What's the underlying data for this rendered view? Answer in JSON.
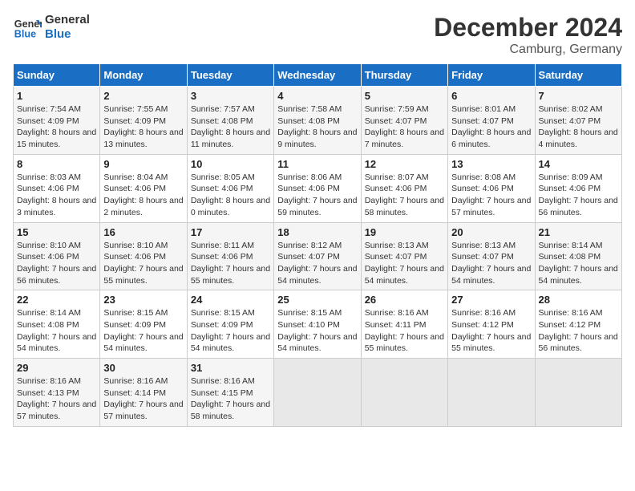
{
  "header": {
    "logo_line1": "General",
    "logo_line2": "Blue",
    "title": "December 2024",
    "subtitle": "Camburg, Germany"
  },
  "weekdays": [
    "Sunday",
    "Monday",
    "Tuesday",
    "Wednesday",
    "Thursday",
    "Friday",
    "Saturday"
  ],
  "weeks": [
    [
      {
        "day": "1",
        "sunrise": "Sunrise: 7:54 AM",
        "sunset": "Sunset: 4:09 PM",
        "daylight": "Daylight: 8 hours and 15 minutes."
      },
      {
        "day": "2",
        "sunrise": "Sunrise: 7:55 AM",
        "sunset": "Sunset: 4:09 PM",
        "daylight": "Daylight: 8 hours and 13 minutes."
      },
      {
        "day": "3",
        "sunrise": "Sunrise: 7:57 AM",
        "sunset": "Sunset: 4:08 PM",
        "daylight": "Daylight: 8 hours and 11 minutes."
      },
      {
        "day": "4",
        "sunrise": "Sunrise: 7:58 AM",
        "sunset": "Sunset: 4:08 PM",
        "daylight": "Daylight: 8 hours and 9 minutes."
      },
      {
        "day": "5",
        "sunrise": "Sunrise: 7:59 AM",
        "sunset": "Sunset: 4:07 PM",
        "daylight": "Daylight: 8 hours and 7 minutes."
      },
      {
        "day": "6",
        "sunrise": "Sunrise: 8:01 AM",
        "sunset": "Sunset: 4:07 PM",
        "daylight": "Daylight: 8 hours and 6 minutes."
      },
      {
        "day": "7",
        "sunrise": "Sunrise: 8:02 AM",
        "sunset": "Sunset: 4:07 PM",
        "daylight": "Daylight: 8 hours and 4 minutes."
      }
    ],
    [
      {
        "day": "8",
        "sunrise": "Sunrise: 8:03 AM",
        "sunset": "Sunset: 4:06 PM",
        "daylight": "Daylight: 8 hours and 3 minutes."
      },
      {
        "day": "9",
        "sunrise": "Sunrise: 8:04 AM",
        "sunset": "Sunset: 4:06 PM",
        "daylight": "Daylight: 8 hours and 2 minutes."
      },
      {
        "day": "10",
        "sunrise": "Sunrise: 8:05 AM",
        "sunset": "Sunset: 4:06 PM",
        "daylight": "Daylight: 8 hours and 0 minutes."
      },
      {
        "day": "11",
        "sunrise": "Sunrise: 8:06 AM",
        "sunset": "Sunset: 4:06 PM",
        "daylight": "Daylight: 7 hours and 59 minutes."
      },
      {
        "day": "12",
        "sunrise": "Sunrise: 8:07 AM",
        "sunset": "Sunset: 4:06 PM",
        "daylight": "Daylight: 7 hours and 58 minutes."
      },
      {
        "day": "13",
        "sunrise": "Sunrise: 8:08 AM",
        "sunset": "Sunset: 4:06 PM",
        "daylight": "Daylight: 7 hours and 57 minutes."
      },
      {
        "day": "14",
        "sunrise": "Sunrise: 8:09 AM",
        "sunset": "Sunset: 4:06 PM",
        "daylight": "Daylight: 7 hours and 56 minutes."
      }
    ],
    [
      {
        "day": "15",
        "sunrise": "Sunrise: 8:10 AM",
        "sunset": "Sunset: 4:06 PM",
        "daylight": "Daylight: 7 hours and 56 minutes."
      },
      {
        "day": "16",
        "sunrise": "Sunrise: 8:10 AM",
        "sunset": "Sunset: 4:06 PM",
        "daylight": "Daylight: 7 hours and 55 minutes."
      },
      {
        "day": "17",
        "sunrise": "Sunrise: 8:11 AM",
        "sunset": "Sunset: 4:06 PM",
        "daylight": "Daylight: 7 hours and 55 minutes."
      },
      {
        "day": "18",
        "sunrise": "Sunrise: 8:12 AM",
        "sunset": "Sunset: 4:07 PM",
        "daylight": "Daylight: 7 hours and 54 minutes."
      },
      {
        "day": "19",
        "sunrise": "Sunrise: 8:13 AM",
        "sunset": "Sunset: 4:07 PM",
        "daylight": "Daylight: 7 hours and 54 minutes."
      },
      {
        "day": "20",
        "sunrise": "Sunrise: 8:13 AM",
        "sunset": "Sunset: 4:07 PM",
        "daylight": "Daylight: 7 hours and 54 minutes."
      },
      {
        "day": "21",
        "sunrise": "Sunrise: 8:14 AM",
        "sunset": "Sunset: 4:08 PM",
        "daylight": "Daylight: 7 hours and 54 minutes."
      }
    ],
    [
      {
        "day": "22",
        "sunrise": "Sunrise: 8:14 AM",
        "sunset": "Sunset: 4:08 PM",
        "daylight": "Daylight: 7 hours and 54 minutes."
      },
      {
        "day": "23",
        "sunrise": "Sunrise: 8:15 AM",
        "sunset": "Sunset: 4:09 PM",
        "daylight": "Daylight: 7 hours and 54 minutes."
      },
      {
        "day": "24",
        "sunrise": "Sunrise: 8:15 AM",
        "sunset": "Sunset: 4:09 PM",
        "daylight": "Daylight: 7 hours and 54 minutes."
      },
      {
        "day": "25",
        "sunrise": "Sunrise: 8:15 AM",
        "sunset": "Sunset: 4:10 PM",
        "daylight": "Daylight: 7 hours and 54 minutes."
      },
      {
        "day": "26",
        "sunrise": "Sunrise: 8:16 AM",
        "sunset": "Sunset: 4:11 PM",
        "daylight": "Daylight: 7 hours and 55 minutes."
      },
      {
        "day": "27",
        "sunrise": "Sunrise: 8:16 AM",
        "sunset": "Sunset: 4:12 PM",
        "daylight": "Daylight: 7 hours and 55 minutes."
      },
      {
        "day": "28",
        "sunrise": "Sunrise: 8:16 AM",
        "sunset": "Sunset: 4:12 PM",
        "daylight": "Daylight: 7 hours and 56 minutes."
      }
    ],
    [
      {
        "day": "29",
        "sunrise": "Sunrise: 8:16 AM",
        "sunset": "Sunset: 4:13 PM",
        "daylight": "Daylight: 7 hours and 57 minutes."
      },
      {
        "day": "30",
        "sunrise": "Sunrise: 8:16 AM",
        "sunset": "Sunset: 4:14 PM",
        "daylight": "Daylight: 7 hours and 57 minutes."
      },
      {
        "day": "31",
        "sunrise": "Sunrise: 8:16 AM",
        "sunset": "Sunset: 4:15 PM",
        "daylight": "Daylight: 7 hours and 58 minutes."
      },
      null,
      null,
      null,
      null
    ]
  ]
}
